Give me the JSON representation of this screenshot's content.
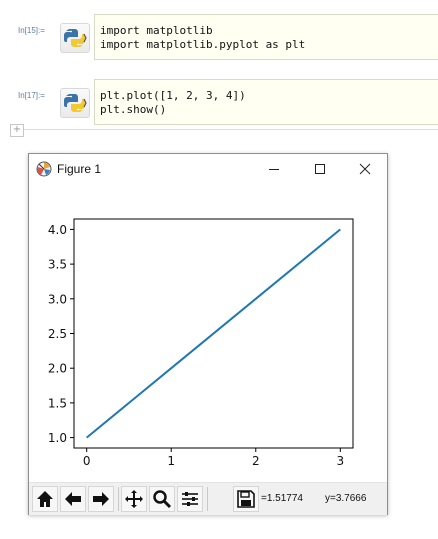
{
  "cells": [
    {
      "prompt": "In[15]:=",
      "language_icon": "python-logo-icon",
      "lines": [
        "import matplotlib",
        "import matplotlib.pyplot as plt"
      ]
    },
    {
      "prompt": "In[17]:=",
      "language_icon": "python-logo-icon",
      "lines": [
        "plt.plot([1, 2, 3, 4])",
        "plt.show()"
      ]
    }
  ],
  "add_cell_label": "+",
  "figure_window": {
    "title": "Figure 1",
    "app_icon": "matplotlib-figure-icon",
    "controls": [
      "minimize-icon",
      "maximize-icon",
      "close-icon"
    ],
    "toolbar": {
      "tools": [
        "home-icon",
        "back-arrow-icon",
        "forward-arrow-icon",
        "pan-icon",
        "zoom-icon",
        "configure-subplots-icon",
        "save-icon"
      ],
      "x_readout": "=1.51774",
      "y_readout": "y=3.7666"
    }
  },
  "chart_data": {
    "type": "line",
    "x": [
      0,
      1,
      2,
      3
    ],
    "series": [
      {
        "values": [
          1,
          2,
          3,
          4
        ],
        "color": "#1f77b4"
      }
    ],
    "xlim": [
      -0.15,
      3.15
    ],
    "ylim": [
      0.85,
      4.15
    ],
    "xticks": [
      0,
      1,
      2,
      3
    ],
    "xtick_labels": [
      "0",
      "1",
      "2",
      "3"
    ],
    "yticks": [
      1.0,
      1.5,
      2.0,
      2.5,
      3.0,
      3.5,
      4.0
    ],
    "ytick_labels": [
      "1.0",
      "1.5",
      "2.0",
      "2.5",
      "3.0",
      "3.5",
      "4.0"
    ],
    "grid": false
  }
}
